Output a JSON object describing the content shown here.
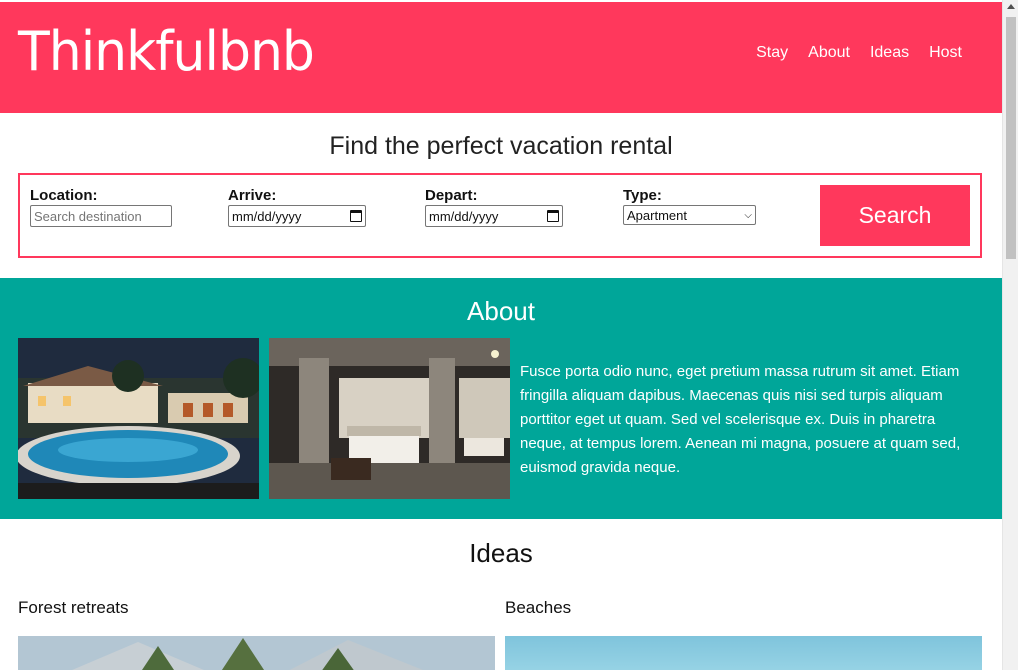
{
  "header": {
    "logo": "Thinkfulbnb",
    "nav": [
      "Stay",
      "About",
      "Ideas",
      "Host"
    ],
    "color": "#ff385c"
  },
  "search": {
    "title": "Find the perfect vacation rental",
    "location_label": "Location:",
    "location_placeholder": "Search destination",
    "arrive_label": "Arrive:",
    "arrive_value": "mm/dd/yyyy",
    "depart_label": "Depart:",
    "depart_value": "mm/dd/yyyy",
    "type_label": "Type:",
    "type_value": "Apartment",
    "button": "Search"
  },
  "about": {
    "title": "About",
    "text": "Fusce porta odio nunc, eget pretium massa rutrum sit amet. Etiam fringilla aliquam dapibus. Maecenas quis nisi sed turpis aliquam porttitor eget ut quam. Sed vel scelerisque ex. Duis in pharetra neque, at tempus lorem. Aenean mi magna, posuere at quam sed, euismod gravida neque.",
    "color": "#00a699"
  },
  "ideas": {
    "title": "Ideas",
    "items": [
      "Forest retreats",
      "Beaches"
    ]
  }
}
